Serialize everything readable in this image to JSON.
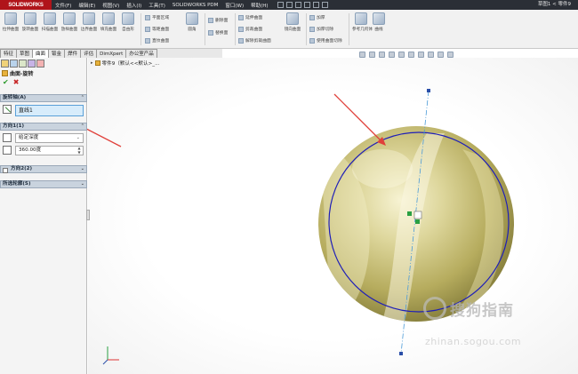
{
  "app": {
    "logo": "SOLIDWORKS",
    "menu": [
      "文件(F)",
      "编辑(E)",
      "视图(V)",
      "插入(I)",
      "工具(T)",
      "SOLIDWORKS PDM",
      "窗口(W)",
      "帮助(H)"
    ],
    "document_title": "草图1 < 零件9"
  },
  "ribbon": {
    "big_buttons": [
      "拉伸曲面",
      "旋转曲面",
      "扫描曲面",
      "放样曲面",
      "边界曲面",
      "填充曲面",
      "自由形"
    ],
    "group1": [
      "平面区域",
      "等距曲面",
      "直纹曲面"
    ],
    "fillet": "圆角",
    "group2": [
      "删除面",
      "替换面"
    ],
    "group3": [
      "延伸曲面",
      "剪裁曲面",
      "解除剪裁曲面"
    ],
    "mirror": "镜向曲面",
    "group4": [
      "加厚",
      "加厚切除",
      "使用曲面切除"
    ],
    "ref_geometry": "参考几何体",
    "curves": "曲线"
  },
  "tabs": [
    "特征",
    "草图",
    "曲面",
    "钣金",
    "焊件",
    "评估",
    "DimXpert",
    "办公室产品"
  ],
  "active_tab": "曲面",
  "tree": {
    "breadcrumb": "零件9（默认<<默认>_..."
  },
  "property_manager": {
    "title": "曲面-旋转",
    "sections": {
      "axis": "旋转轴(A)",
      "direction1": "方向1(1)",
      "direction2": "方向2(2)",
      "contours": "所选轮廓(S)"
    },
    "axis_value": "直线1",
    "end_condition": "给定深度",
    "angle": "360.00度"
  },
  "watermark": {
    "text": "搜狗指南",
    "url": "zhinan.sogou.com"
  },
  "colors": {
    "surface": "#c9c07a",
    "sketch_circle": "#1f1fb8",
    "axis_line": "#4a9ad8",
    "annotation_arrow": "#e0403a",
    "selection_field": "#d7ecfb"
  }
}
